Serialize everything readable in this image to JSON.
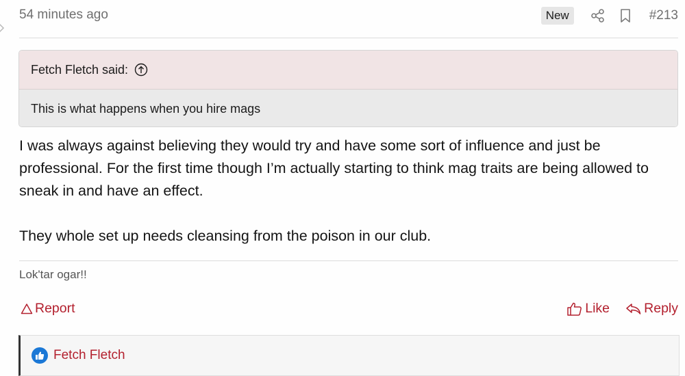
{
  "post": {
    "timestamp": "54 minutes ago",
    "new_badge": "New",
    "post_number": "#213"
  },
  "quote": {
    "author_said": "Fetch Fletch said:",
    "text": "This is what happens when you hire mags"
  },
  "body": {
    "paragraphs": [
      "I was always against believing they would try and have some sort of influence and just be professional. For the first time though I’m actually starting to think mag traits are being allowed to sneak in and have an effect.",
      "They whole set up needs cleansing from the poison in our club."
    ]
  },
  "signature": "Lok'tar ogar!!",
  "actions": {
    "report": "Report",
    "like": "Like",
    "reply": "Reply"
  },
  "reactions": {
    "user": "Fetch Fletch"
  },
  "icons": {
    "share": "share-icon",
    "bookmark": "bookmark-icon",
    "quote_jump": "arrow-up-circle-icon",
    "report": "warning-icon",
    "like": "thumbs-up-icon",
    "reply": "reply-icon",
    "reaction": "like-reaction-icon"
  },
  "colors": {
    "accent": "#b3202e",
    "quote_header_bg": "#f1e4e5",
    "quote_body_bg": "#eaeaea",
    "reaction_blue": "#1b78d6"
  }
}
